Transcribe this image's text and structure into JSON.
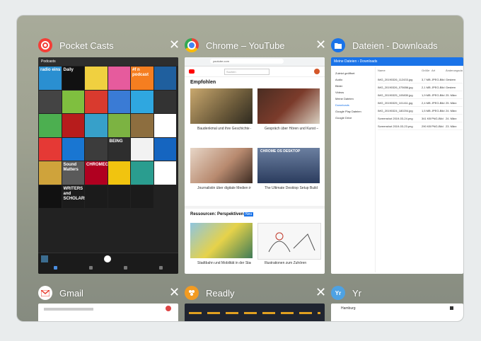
{
  "recents": {
    "top": [
      {
        "id": "pocketcasts",
        "title": "Pocket Casts",
        "icon": "pocket-casts-icon",
        "color": "#f43e37"
      },
      {
        "id": "chrome",
        "title": "Chrome – YouTube",
        "icon": "chrome-icon",
        "color": "#4285f4"
      },
      {
        "id": "files",
        "title": "Dateien - Downloads",
        "icon": "files-icon",
        "color": "#1a73e8"
      }
    ],
    "bottom": [
      {
        "id": "gmail",
        "title": "Gmail",
        "icon": "gmail-icon",
        "color": "#ea4335"
      },
      {
        "id": "readly",
        "title": "Readly",
        "icon": "readly-icon",
        "color": "#f29b22"
      },
      {
        "id": "yr",
        "title": "Yr",
        "icon": "yr-icon",
        "color": "#4ea2e3"
      }
    ]
  },
  "pocketcasts": {
    "header": "Podcasts",
    "tiles": [
      "radio eins",
      "Daily",
      "",
      "",
      "#f n podcast",
      "",
      "",
      "",
      "",
      "",
      "",
      "",
      "",
      "",
      "",
      "",
      "",
      "",
      "",
      "",
      "",
      "BEING",
      "",
      "",
      "",
      "Sound Matters",
      "CHROMECAST",
      "",
      "",
      "",
      "",
      "WRITERS and SCHOLARS",
      "",
      "",
      ""
    ]
  },
  "youtube": {
    "url": "youtube.com",
    "search_placeholder": "Suchen",
    "section": "Empfohlen",
    "video1": "Baudenkmal und ihre Geschichte – Bildung kompakt",
    "video2": "Gespräch über Hören und Kunst – Podcast",
    "video3": "Journalistin über digitale Medien im Gespräch",
    "video4": "The Ultimate Desktop Setup Build",
    "banner": "CHROME OS DESKTOP",
    "promo_title": "Ressourcen: Perspektiven",
    "promo_badge": "Neu",
    "video5": "Stadtbahn und Mobilität in der Stadt",
    "video6": "Illustrationen zum Zuhören"
  },
  "files": {
    "breadcrumb": "Meine Dateien  ›  Downloads",
    "sidebar": [
      "Zuletzt geöffnet",
      "Audio",
      "Bilder",
      "Videos",
      "Meine Dateien",
      "Downloads",
      "Google Play Dateien",
      "Google Drive"
    ],
    "columns": [
      "Name",
      "Größe",
      "Art",
      "Änderungsdatum"
    ],
    "rows": [
      [
        "IMG_20190326_112433.jpg",
        "3,7 MB",
        "JPEG-Bild",
        "Gestern"
      ],
      [
        "IMG_20190326_075656.jpg",
        "2,1 MB",
        "JPEG-Bild",
        "Gestern"
      ],
      [
        "IMG_20190325_105830.jpg",
        "1,9 MB",
        "JPEG-Bild",
        "25. März"
      ],
      [
        "IMG_20190325_101411.jpg",
        "2,4 MB",
        "JPEG-Bild",
        "25. März"
      ],
      [
        "IMG_20190324_180204.jpg",
        "1,5 MB",
        "JPEG-Bild",
        "24. März"
      ],
      [
        "Screenshot 2019-03-24.png",
        "341 KB",
        "PNG-Bild",
        "24. März"
      ],
      [
        "Screenshot 2019-03-23.png",
        "290 KB",
        "PNG-Bild",
        "23. März"
      ]
    ]
  },
  "gmail": {
    "title": "Gmail"
  },
  "readly": {
    "title": "Readly"
  },
  "yr": {
    "title": "Yr",
    "location": "Hamburg"
  }
}
